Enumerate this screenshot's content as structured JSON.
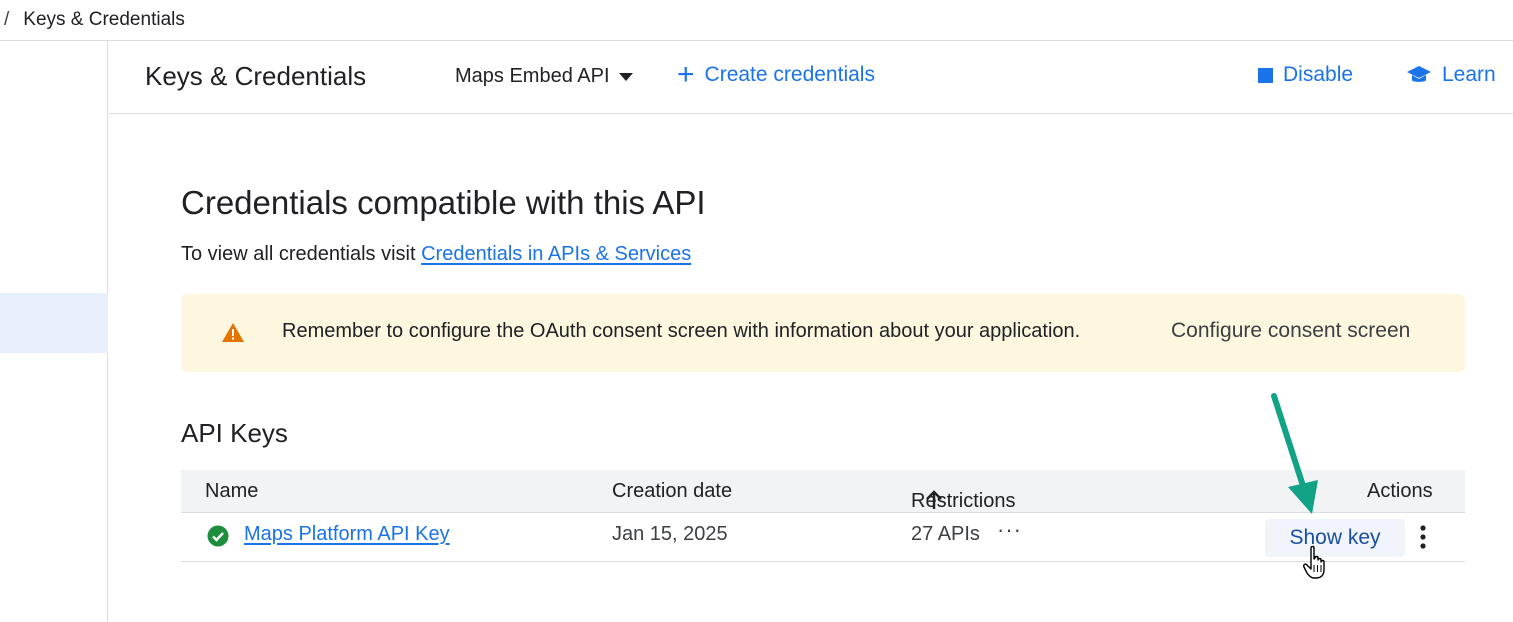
{
  "breadcrumb": {
    "separator": "/",
    "current": "Keys & Credentials"
  },
  "header": {
    "title": "Keys & Credentials",
    "api_select": "Maps Embed API",
    "create_label": "Create credentials",
    "disable_label": "Disable",
    "learn_label": "Learn"
  },
  "main": {
    "title": "Credentials compatible with this API",
    "subtitle_prefix": "To view all credentials visit",
    "subtitle_link": "Credentials in APIs & Services"
  },
  "banner": {
    "message": "Remember to configure the OAuth consent screen with information about your application.",
    "action": "Configure consent screen"
  },
  "api_keys": {
    "title": "API Keys",
    "columns": {
      "name": "Name",
      "creation_date": "Creation date",
      "restrictions": "Restrictions",
      "actions": "Actions"
    },
    "rows": [
      {
        "name": "Maps Platform API Key",
        "creation_date": "Jan 15, 2025",
        "restrictions": "27 APIs",
        "action": "Show key"
      }
    ]
  },
  "colors": {
    "accent": "#1a73e8",
    "warning": "#e37400",
    "success": "#1e8e3e",
    "annotation_arrow": "#12a386"
  },
  "icons": [
    "chevron-down-icon",
    "plus-icon",
    "stop-icon",
    "school-icon",
    "warning-icon",
    "check-circle-icon",
    "arrow-up-icon",
    "more-horiz-icon",
    "more-vert-icon",
    "hand-pointer-icon"
  ]
}
